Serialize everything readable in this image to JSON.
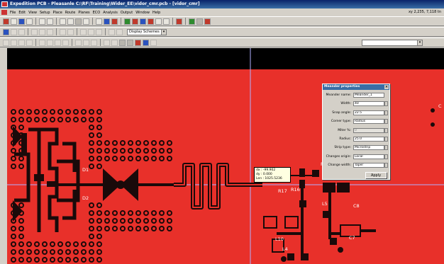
{
  "window": {
    "title": "Expedition PCB - Pleasanle  C:\\RF\\Training\\Wider_EE\\vidor_cmr.pcb - [vidor_cmr]"
  },
  "menu": {
    "items": [
      "File",
      "Edit",
      "View",
      "Setup",
      "Place",
      "Route",
      "Planes",
      "ECO",
      "Analysis",
      "Output",
      "Window",
      "Help"
    ],
    "coords_readout": "xy 2,235, 7,118  tn"
  },
  "toolbar": {
    "display_scheme": "Display Schemes"
  },
  "meander_properties": {
    "title": "Meander properties",
    "fields": [
      {
        "label": "Meander name:",
        "value": "Meander_1",
        "enabled": true,
        "spinner": false
      },
      {
        "label": "Width:",
        "value": "40",
        "enabled": true,
        "spinner": true
      },
      {
        "label": "Snap angle:",
        "value": "22.5",
        "enabled": true,
        "spinner": true
      },
      {
        "label": "Corner type:",
        "value": "Radius",
        "enabled": true,
        "spinner": true
      },
      {
        "label": "Miter %:",
        "value": "0",
        "enabled": false,
        "spinner": true
      },
      {
        "label": "Radius:",
        "value": "25.0",
        "enabled": true,
        "spinner": true
      },
      {
        "label": "Strip type:",
        "value": "Microstrip",
        "enabled": true,
        "spinner": true
      },
      {
        "label": "Changes origin:",
        "value": "Local",
        "enabled": true,
        "spinner": true
      },
      {
        "label": "Change width:",
        "value": "Taper",
        "enabled": true,
        "spinner": true
      }
    ],
    "apply_label": "Apply"
  },
  "measure_tooltip": {
    "dx": "dx : -99.902",
    "dy": "dy : 0.000",
    "len": "Len : 1025.5236"
  },
  "ref_designators": {
    "d1": "D1",
    "d2": "D2",
    "r17": "R17",
    "r16": "R16",
    "r": "R",
    "l5": "L5",
    "c8": "C8",
    "c7": "C7",
    "l10": "L10",
    "l4": "L4",
    "c": "C"
  },
  "colors": {
    "board": "#e8302a",
    "copper": "#1a0a0a",
    "crosshair": "#b0b0ff"
  }
}
